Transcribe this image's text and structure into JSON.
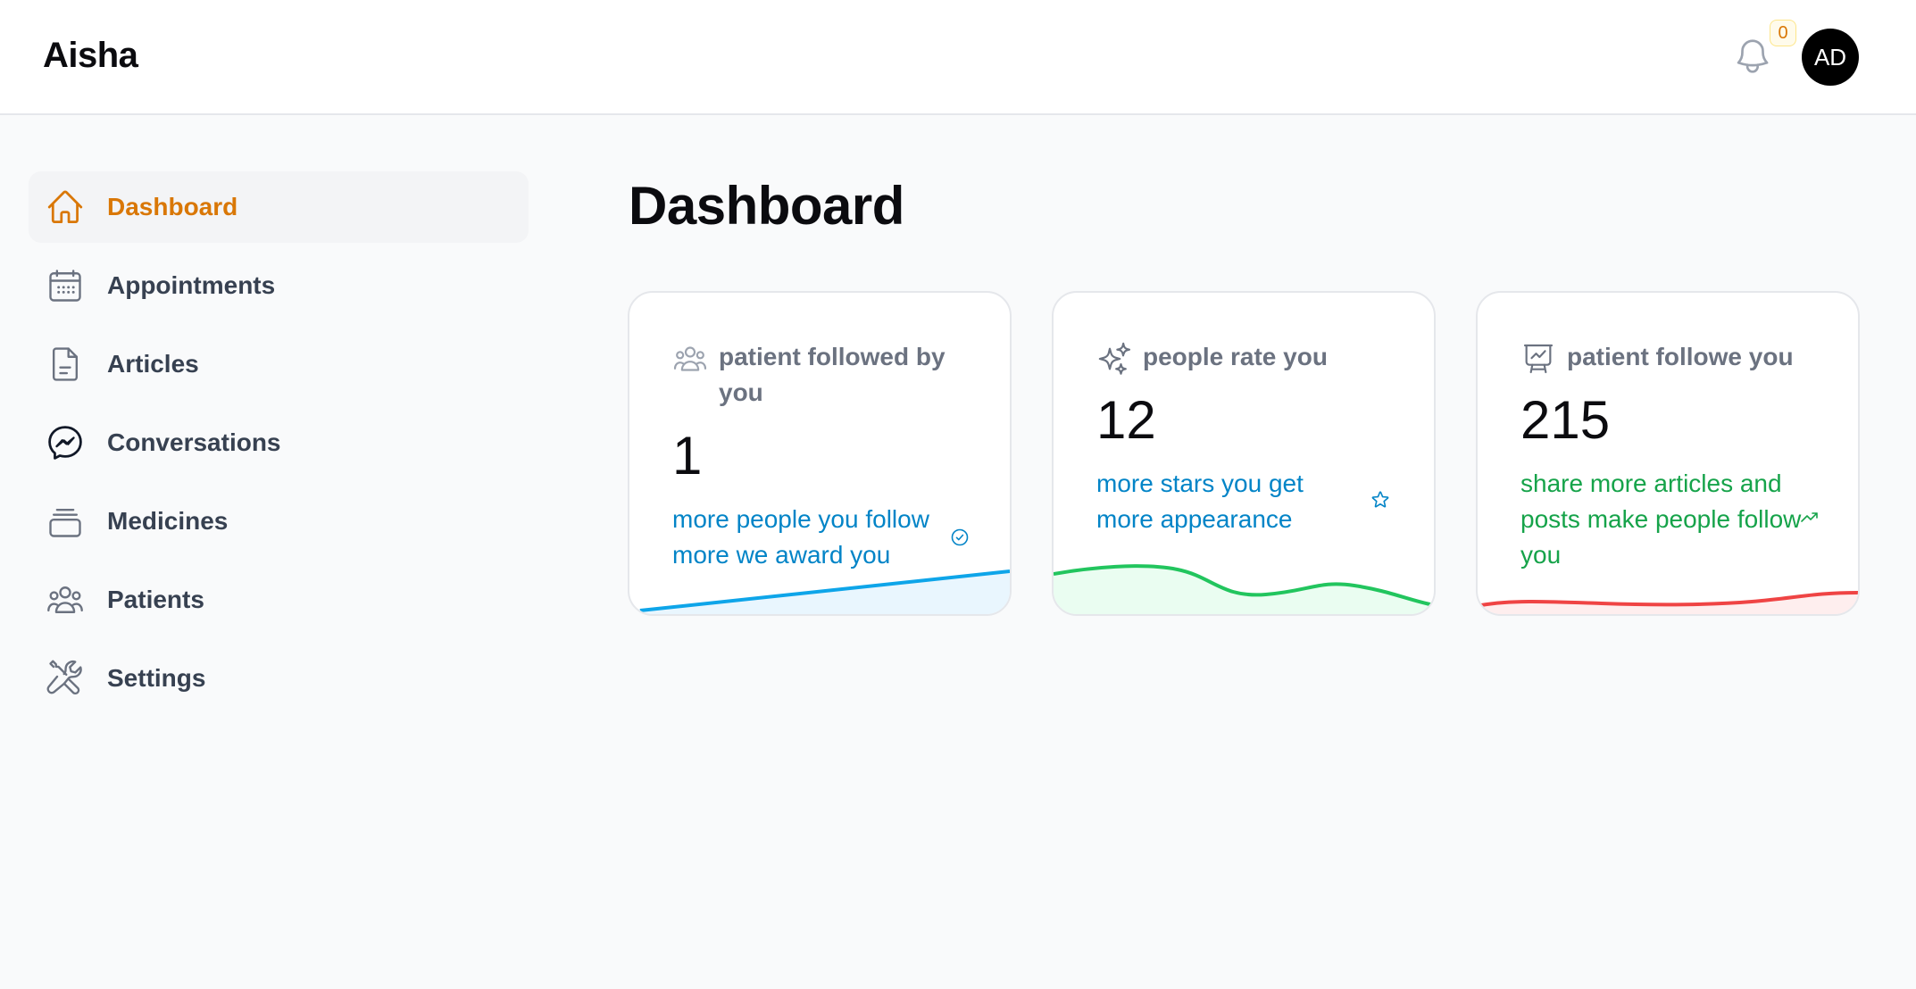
{
  "app": {
    "brand": "Aisha"
  },
  "header": {
    "notification_count": "0",
    "avatar_initials": "AD"
  },
  "sidebar": {
    "items": [
      {
        "label": "Dashboard",
        "icon": "home-icon",
        "active": true
      },
      {
        "label": "Appointments",
        "icon": "calendar-icon",
        "active": false
      },
      {
        "label": "Articles",
        "icon": "document-icon",
        "active": false
      },
      {
        "label": "Conversations",
        "icon": "messenger-icon",
        "active": false
      },
      {
        "label": "Medicines",
        "icon": "stack-icon",
        "active": false
      },
      {
        "label": "Patients",
        "icon": "users-icon",
        "active": false
      },
      {
        "label": "Settings",
        "icon": "tools-icon",
        "active": false
      }
    ]
  },
  "main": {
    "title": "Dashboard",
    "cards": [
      {
        "title": "patient followed by you",
        "value": "1",
        "description": "more people you follow more we award you",
        "icon": "users-icon",
        "description_icon": "check-circle-icon",
        "accent": "#0284c7",
        "trend": "rising"
      },
      {
        "title": "people rate you",
        "value": "12",
        "description": "more stars you get more appearance",
        "icon": "sparkles-icon",
        "description_icon": "star-icon",
        "accent": "#22c55e",
        "trend": "wave"
      },
      {
        "title": "patient followe you",
        "value": "215",
        "description": "share more articles and posts make people follow you",
        "icon": "presentation-chart-icon",
        "description_icon": "trending-up-icon",
        "accent": "#ef4444",
        "trend": "flat-rise"
      }
    ]
  },
  "colors": {
    "accent": "#d97706",
    "blue": "#0284c7",
    "green": "#16a34a",
    "red": "#ef4444"
  }
}
